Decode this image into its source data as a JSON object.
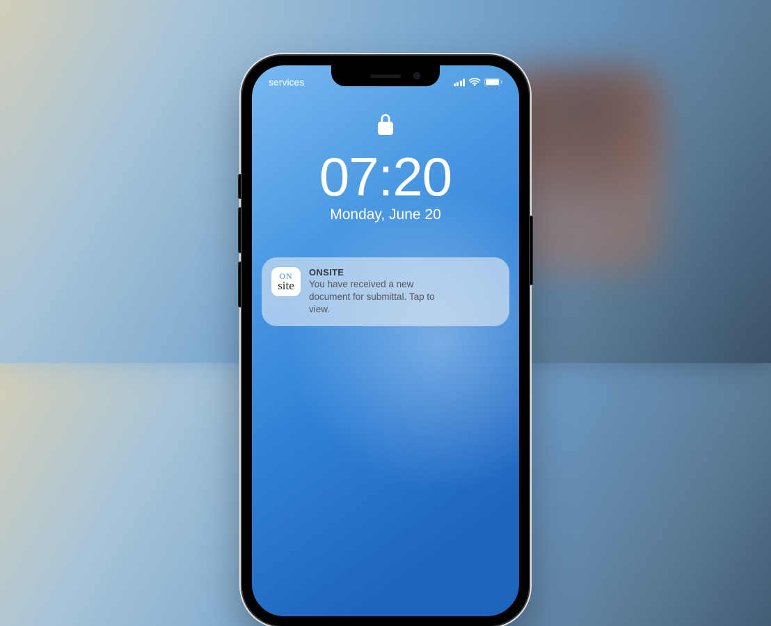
{
  "status_bar": {
    "carrier": "services"
  },
  "lock_screen": {
    "time": "07:20",
    "date": "Monday, June 20"
  },
  "notification": {
    "app_icon": {
      "line1": "ON",
      "line2": "site"
    },
    "app_name": "ONSITE",
    "message": "You have received a new document for submittal. Tap to view."
  }
}
